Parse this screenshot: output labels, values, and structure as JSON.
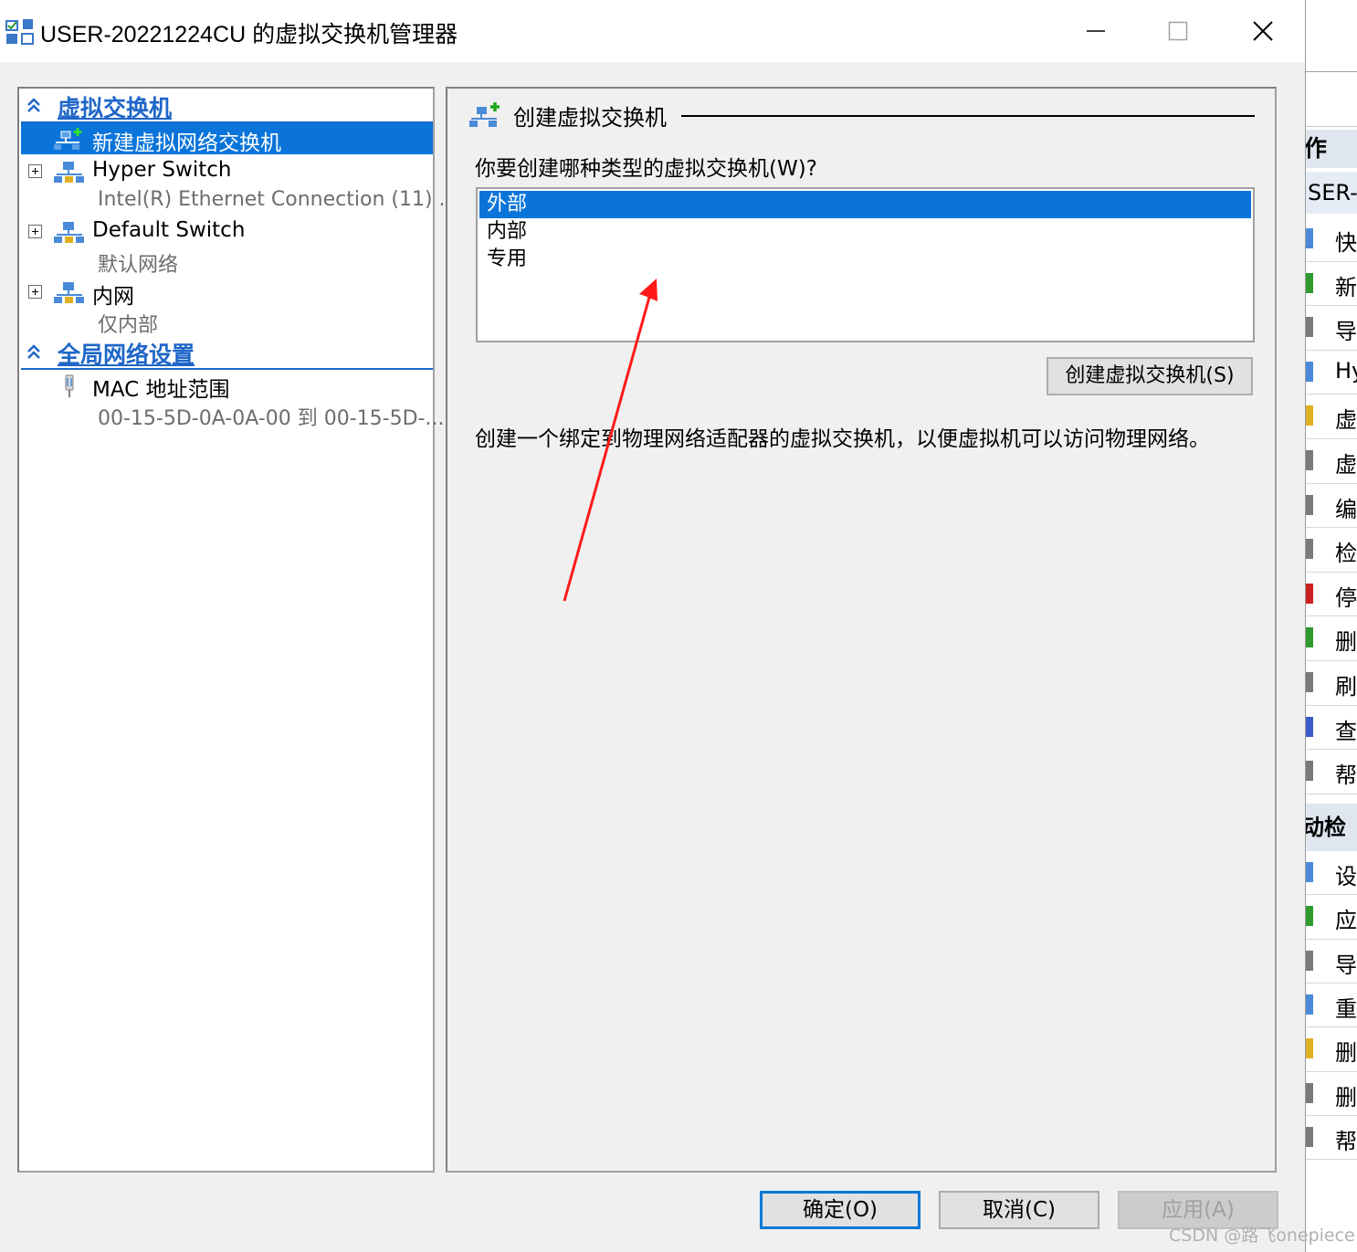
{
  "window": {
    "title": "USER-20221224CU 的虚拟交换机管理器",
    "minimize_icon": "minimize-icon",
    "maximize_icon": "maximize-icon",
    "close_icon": "close-icon"
  },
  "tree": {
    "section_switches": "虚拟交换机",
    "new_switch": "新建虚拟网络交换机",
    "switches": [
      {
        "name": "Hyper Switch",
        "detail": "Intel(R) Ethernet Connection (11) ..."
      },
      {
        "name": "Default Switch",
        "detail": "默认网络"
      },
      {
        "name": "内网",
        "detail": "仅内部"
      }
    ],
    "section_global": "全局网络设置",
    "mac_range": {
      "name": "MAC 地址范围",
      "detail": "00-15-5D-0A-0A-00 到 00-15-5D-..."
    }
  },
  "detail": {
    "title": "创建虚拟交换机",
    "question": "你要创建哪种类型的虚拟交换机(W)?",
    "types": [
      "外部",
      "内部",
      "专用"
    ],
    "selected_type": "外部",
    "create_button": "创建虚拟交换机(S)",
    "description": "创建一个绑定到物理网络适配器的虚拟交换机，以便虚拟机可以访问物理网络。"
  },
  "buttons": {
    "ok": "确定(O)",
    "cancel": "取消(C)",
    "apply": "应用(A)"
  },
  "background_window": {
    "header_actions": "作",
    "header_server": "SER-",
    "items_1": [
      "快",
      "新",
      "导",
      "Hy",
      "虚",
      "虚",
      "编",
      "检",
      "停",
      "删",
      "刷",
      "查",
      "帮"
    ],
    "header_auto": "动检",
    "items_2": [
      "设",
      "应",
      "导",
      "重",
      "删",
      "删",
      "帮"
    ]
  },
  "watermark": "CSDN @路飞onepiece",
  "colors": {
    "selection": "#0a74da",
    "section_link": "#1f66c8",
    "annotation_arrow": "#ff1a1a"
  }
}
